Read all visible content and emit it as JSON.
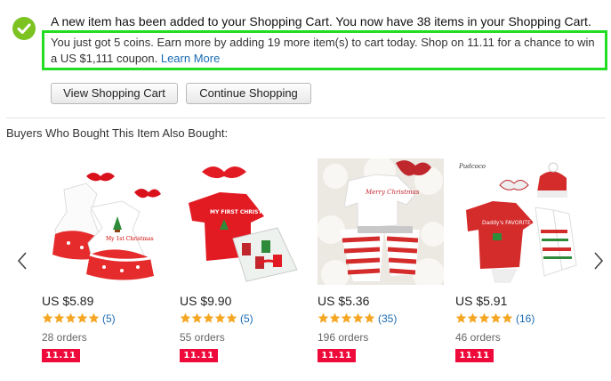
{
  "notice": {
    "headline": "A new item has been added to your Shopping Cart. You now have 38 items in your Shopping Cart.",
    "promo_text": "You just got 5 coins. Earn more by adding 19 more item(s) to cart today. Shop on 11.11 for a chance to win a US $1,111 coupon.",
    "promo_link": "Learn More"
  },
  "buttons": {
    "view_cart": "View Shopping Cart",
    "continue": "Continue Shopping"
  },
  "recommendations": {
    "title": "Buyers Who Bought This Item Also Bought:",
    "products": [
      {
        "price": "US $5.89",
        "reviews": "(5)",
        "orders": "28 orders",
        "badge": "11.11",
        "rating": 5
      },
      {
        "price": "US $9.90",
        "reviews": "(5)",
        "orders": "55 orders",
        "badge": "11.11",
        "rating": 5
      },
      {
        "price": "US $5.36",
        "reviews": "(35)",
        "orders": "196 orders",
        "badge": "11.11",
        "rating": 5
      },
      {
        "price": "US $5.91",
        "reviews": "(16)",
        "orders": "46 orders",
        "badge": "11.11",
        "rating": 5
      }
    ]
  },
  "image_text": {
    "p1": "My 1st Christmas",
    "p2": "MY FIRST CHRISTMAS",
    "p3": "Merry Christmas",
    "p4_brand": "Pudcoco",
    "p4": "Daddy's FAVORITE Gift"
  },
  "colors": {
    "accent_green": "#7cc322",
    "highlight_border": "#22dd22",
    "link": "#1a6bb3",
    "star": "#f5a623",
    "badge": "#ee0a3b"
  },
  "icons": {
    "success": "check-circle-icon",
    "prev": "chevron-left-icon",
    "next": "chevron-right-icon",
    "rating": "star-icon"
  }
}
